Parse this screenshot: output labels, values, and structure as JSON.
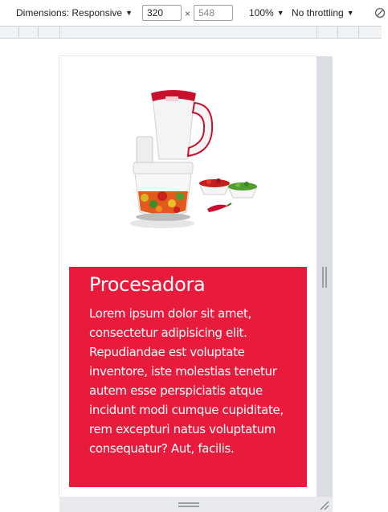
{
  "devtools": {
    "dimensions_label": "Dimensions: Responsive",
    "width_value": "320",
    "height_placeholder": "548",
    "times_symbol": "×",
    "zoom_label": "100%",
    "throttling_label": "No throttling",
    "caret": "▼"
  },
  "page": {
    "title": "Procesadora",
    "description": "Lorem ipsum dolor sit amet, consectetur adipisicing elit. Repudiandae est voluptate inventore, iste molestias tenetur autem esse perspiciatis atque incidunt modi cumque cupiditate, rem excepturi natus voluptatum consequatur? Aut, facilis.",
    "accent_color": "#e91b3c"
  },
  "icons": [
    "caret-down-icon",
    "rotate-icon",
    "resize-grip-icon",
    "food-processor-image"
  ]
}
